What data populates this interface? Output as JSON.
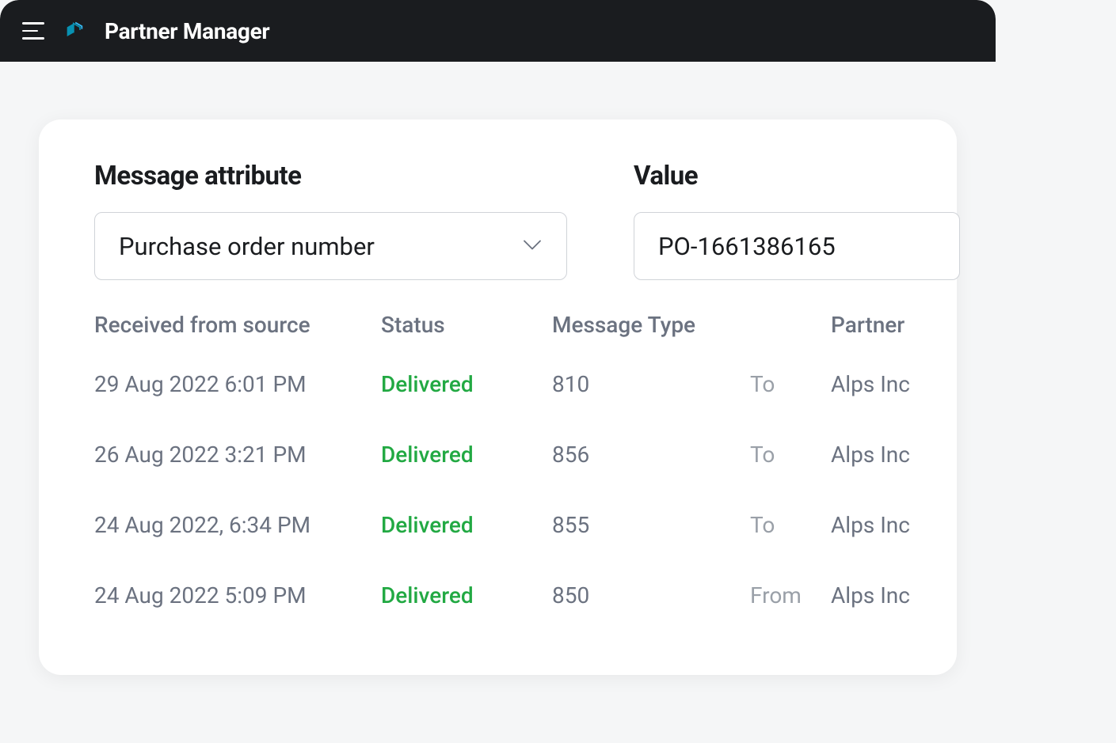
{
  "header": {
    "app_title": "Partner Manager"
  },
  "filter": {
    "attribute_label": "Message attribute",
    "attribute_value": "Purchase order number",
    "value_label": "Value",
    "value_value": "PO-1661386165"
  },
  "table": {
    "headers": {
      "received": "Received from source",
      "status": "Status",
      "message_type": "Message Type",
      "partner": "Partner"
    },
    "rows": [
      {
        "received": "29 Aug 2022  6:01 PM",
        "status": "Delivered",
        "message_type": "810",
        "direction": "To",
        "partner": "Alps Inc"
      },
      {
        "received": "26 Aug 2022  3:21 PM",
        "status": "Delivered",
        "message_type": "856",
        "direction": "To",
        "partner": "Alps Inc"
      },
      {
        "received": "24 Aug 2022, 6:34 PM",
        "status": "Delivered",
        "message_type": "855",
        "direction": "To",
        "partner": "Alps Inc"
      },
      {
        "received": "24 Aug 2022  5:09 PM",
        "status": "Delivered",
        "message_type": "850",
        "direction": "From",
        "partner": "Alps Inc"
      }
    ]
  }
}
